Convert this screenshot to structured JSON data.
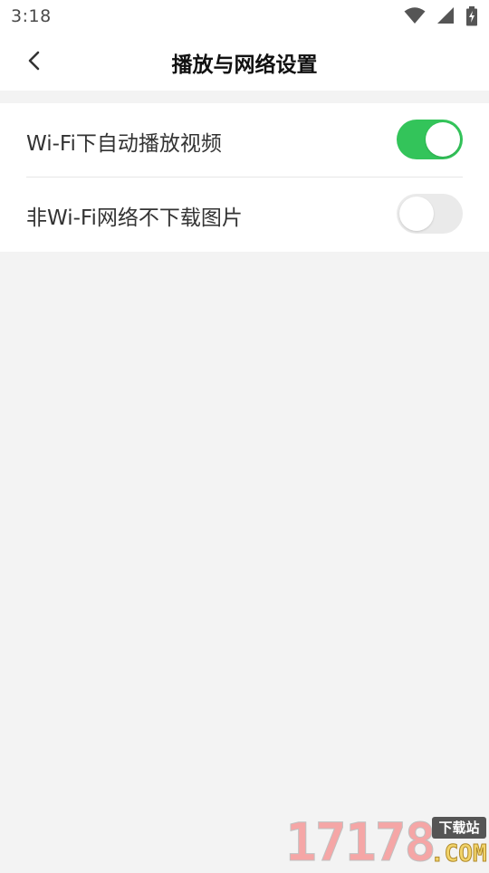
{
  "status_bar": {
    "time": "3:18",
    "icons": [
      "wifi-icon",
      "cellular-signal-icon",
      "battery-charging-icon"
    ]
  },
  "app_bar": {
    "back_icon": "chevron-left-icon",
    "title": "播放与网络设置"
  },
  "settings": {
    "items": [
      {
        "label": "Wi-Fi下自动播放视频",
        "enabled": true
      },
      {
        "label": "非Wi-Fi网络不下载图片",
        "enabled": false
      }
    ]
  },
  "watermark": {
    "number": "17178",
    "badge": "下载站",
    "domain": ".COM"
  },
  "colors": {
    "toggle_on": "#33c45a",
    "toggle_off": "#eaeaea",
    "background": "#f3f3f3"
  }
}
